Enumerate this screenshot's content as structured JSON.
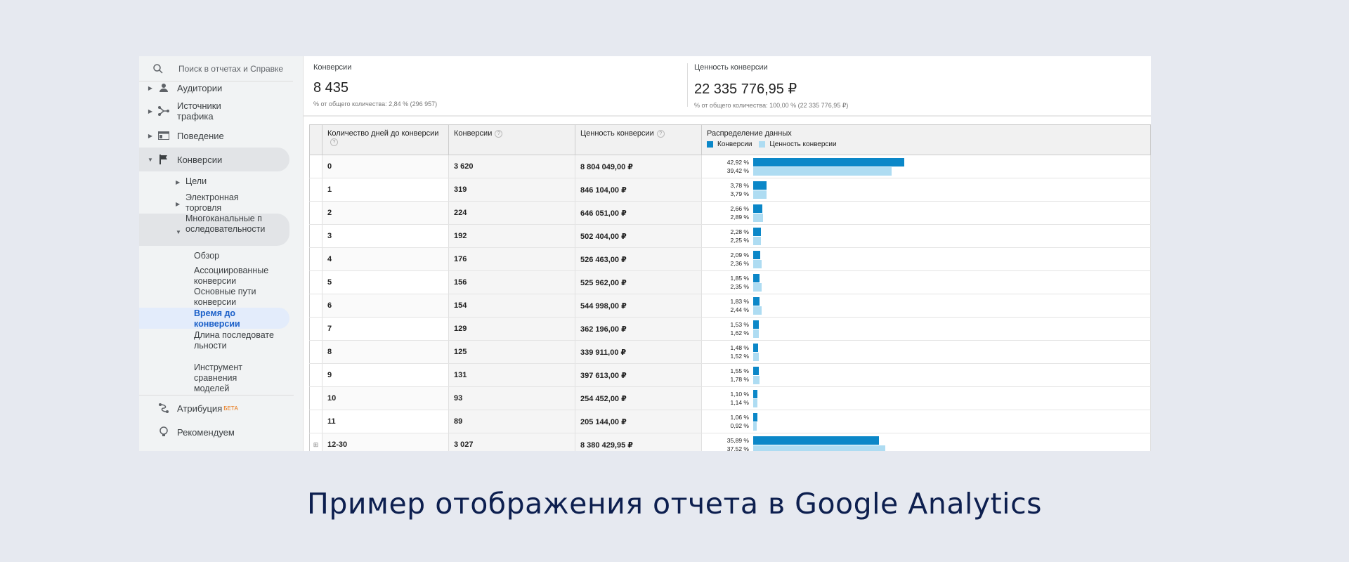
{
  "sidebar": {
    "search_placeholder": "Поиск в отчетах и Справке",
    "items": [
      {
        "label": "Аудитории",
        "icon": "person-icon"
      },
      {
        "label": "Источники трафика",
        "icon": "fork-icon"
      },
      {
        "label": "Поведение",
        "icon": "window-icon"
      },
      {
        "label": "Конверсии",
        "icon": "flag-icon"
      }
    ],
    "sub_items": {
      "goals": "Цели",
      "ecommerce": "Электронная торговля",
      "mcf": "Многоканальные последовательности",
      "overview": "Обзор",
      "assisted": "Ассоциированные конверсии",
      "top_paths": "Основные пути конверсии",
      "time_lag": "Время до конверсии",
      "path_length": "Длина последовательности",
      "model_compare": "Инструмент сравнения моделей"
    },
    "attribution": {
      "label": "Атрибуция",
      "badge": "БЕТА"
    },
    "recommend": "Рекомендуем"
  },
  "scorecards": {
    "conversions": {
      "label": "Конверсии",
      "value": "8 435",
      "sub": "% от общего количества: 2,84 % (296 957)"
    },
    "value": {
      "label": "Ценность конверсии",
      "value": "22 335 776,95 ₽",
      "sub": "% от общего количества: 100,00 % (22 335 776,95 ₽)"
    }
  },
  "table": {
    "headers": {
      "days": "Количество дней до конверсии",
      "conv": "Конверсии",
      "value": "Ценность конверсии",
      "dist": "Распределение данных"
    },
    "legend": {
      "conv": "Конверсии",
      "value": "Ценность конверсии"
    },
    "colors": {
      "conv": "#0b87c8",
      "value": "#aedcf2"
    },
    "rows": [
      {
        "days": "0",
        "conv": "3 620",
        "value": "8 804 049,00 ₽",
        "p1": "42,92 %",
        "p2": "39,42 %",
        "f1": 42.92,
        "f2": 39.42
      },
      {
        "days": "1",
        "conv": "319",
        "value": "846 104,00 ₽",
        "p1": "3,78 %",
        "p2": "3,79 %",
        "f1": 3.78,
        "f2": 3.79
      },
      {
        "days": "2",
        "conv": "224",
        "value": "646 051,00 ₽",
        "p1": "2,66 %",
        "p2": "2,89 %",
        "f1": 2.66,
        "f2": 2.89
      },
      {
        "days": "3",
        "conv": "192",
        "value": "502 404,00 ₽",
        "p1": "2,28 %",
        "p2": "2,25 %",
        "f1": 2.28,
        "f2": 2.25
      },
      {
        "days": "4",
        "conv": "176",
        "value": "526 463,00 ₽",
        "p1": "2,09 %",
        "p2": "2,36 %",
        "f1": 2.09,
        "f2": 2.36
      },
      {
        "days": "5",
        "conv": "156",
        "value": "525 962,00 ₽",
        "p1": "1,85 %",
        "p2": "2,35 %",
        "f1": 1.85,
        "f2": 2.35
      },
      {
        "days": "6",
        "conv": "154",
        "value": "544 998,00 ₽",
        "p1": "1,83 %",
        "p2": "2,44 %",
        "f1": 1.83,
        "f2": 2.44
      },
      {
        "days": "7",
        "conv": "129",
        "value": "362 196,00 ₽",
        "p1": "1,53 %",
        "p2": "1,62 %",
        "f1": 1.53,
        "f2": 1.62
      },
      {
        "days": "8",
        "conv": "125",
        "value": "339 911,00 ₽",
        "p1": "1,48 %",
        "p2": "1,52 %",
        "f1": 1.48,
        "f2": 1.52
      },
      {
        "days": "9",
        "conv": "131",
        "value": "397 613,00 ₽",
        "p1": "1,55 %",
        "p2": "1,78 %",
        "f1": 1.55,
        "f2": 1.78
      },
      {
        "days": "10",
        "conv": "93",
        "value": "254 452,00 ₽",
        "p1": "1,10 %",
        "p2": "1,14 %",
        "f1": 1.1,
        "f2": 1.14
      },
      {
        "days": "11",
        "conv": "89",
        "value": "205 144,00 ₽",
        "p1": "1,06 %",
        "p2": "0,92 %",
        "f1": 1.06,
        "f2": 0.92
      },
      {
        "days": "12-30",
        "conv": "3 027",
        "value": "8 380 429,95 ₽",
        "p1": "35,89 %",
        "p2": "37,52 %",
        "f1": 35.89,
        "f2": 37.52,
        "expandable": true
      }
    ]
  },
  "caption": "Пример отображения отчета в Google Analytics"
}
